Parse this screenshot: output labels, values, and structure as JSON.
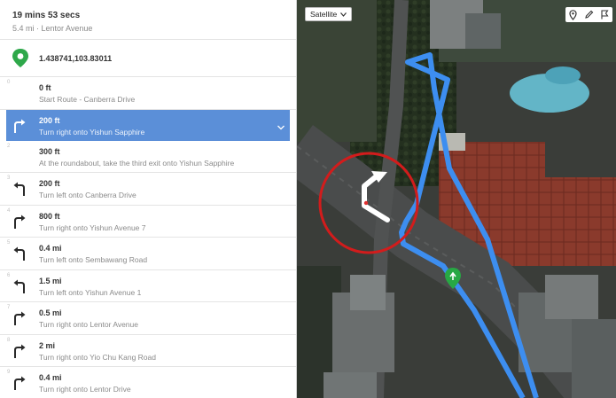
{
  "route": {
    "time": "19 mins 53 secs",
    "summary": "5.4 mi · Lentor Avenue",
    "coordinates": "1.438741,103.83011"
  },
  "steps": [
    {
      "num": "0",
      "distance": "0 ft",
      "instruction": "Start Route - Canberra Drive",
      "icon": "none"
    },
    {
      "num": "1",
      "distance": "200 ft",
      "instruction": "Turn right onto Yishun Sapphire",
      "icon": "turn-right-icon",
      "active": true
    },
    {
      "num": "2",
      "distance": "300 ft",
      "instruction": "At the roundabout, take the third exit onto Yishun Sapphire",
      "icon": "none"
    },
    {
      "num": "3",
      "distance": "200 ft",
      "instruction": "Turn left onto Canberra Drive",
      "icon": "turn-left-icon"
    },
    {
      "num": "4",
      "distance": "800 ft",
      "instruction": "Turn right onto Yishun Avenue 7",
      "icon": "turn-right-icon"
    },
    {
      "num": "5",
      "distance": "0.4 mi",
      "instruction": "Turn left onto Sembawang Road",
      "icon": "turn-left-icon"
    },
    {
      "num": "6",
      "distance": "1.5 mi",
      "instruction": "Turn left onto Yishun Avenue 1",
      "icon": "turn-left-icon"
    },
    {
      "num": "7",
      "distance": "0.5 mi",
      "instruction": "Turn right onto Lentor Avenue",
      "icon": "turn-right-icon"
    },
    {
      "num": "8",
      "distance": "2 mi",
      "instruction": "Turn right onto Yio Chu Kang Road",
      "icon": "turn-right-icon"
    },
    {
      "num": "9",
      "distance": "0.4 mi",
      "instruction": "Turn right onto Lentor Drive",
      "icon": "turn-right-icon"
    }
  ],
  "map": {
    "map_type": "Satellite",
    "tool_icons": [
      "pin-icon",
      "pencil-icon",
      "flag-icon"
    ],
    "route_color": "#3d8ef0",
    "highlight_color": "#d21c1c",
    "marker_color": "#27a844"
  }
}
